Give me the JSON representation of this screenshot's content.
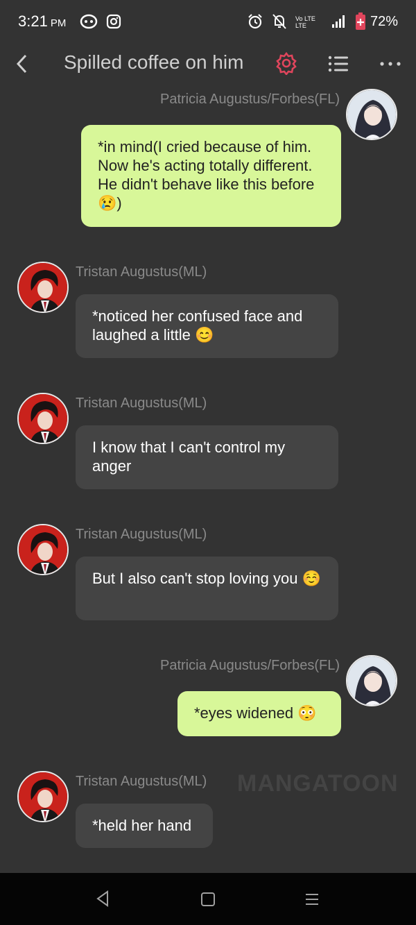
{
  "status_bar": {
    "time": "3:21",
    "ampm": "PM",
    "battery": "72%",
    "icons": [
      "chat-bubble-icon",
      "instagram-icon",
      "alarm-icon",
      "bell-off-icon",
      "volte-icon",
      "signal-icon",
      "battery-icon"
    ]
  },
  "header": {
    "title": "Spilled coffee on him",
    "accent_color": "#e0455c"
  },
  "messages": [
    {
      "sender": "Patricia Augustus/Forbes(FL)",
      "side": "right",
      "text": "*in mind(I cried because of him. Now he's acting totally different. He didn't behave like this before 😢)"
    },
    {
      "sender": "Tristan Augustus(ML)",
      "side": "left",
      "text": "*noticed her confused face and laughed a little 😊"
    },
    {
      "sender": "Tristan Augustus(ML)",
      "side": "left",
      "text": "I know that I can't control my anger"
    },
    {
      "sender": "Tristan Augustus(ML)",
      "side": "left",
      "text": "But I also can't stop loving you ☺️"
    },
    {
      "sender": "Patricia Augustus/Forbes(FL)",
      "side": "right",
      "text": "*eyes widened 😳"
    },
    {
      "sender": "Tristan Augustus(ML)",
      "side": "left",
      "text": "*held her hand"
    }
  ],
  "watermark": "MANGATOON",
  "colors": {
    "background": "#333333",
    "my_bubble": "#d8f799",
    "their_bubble": "#444444",
    "name_text": "#8a8a8a"
  }
}
